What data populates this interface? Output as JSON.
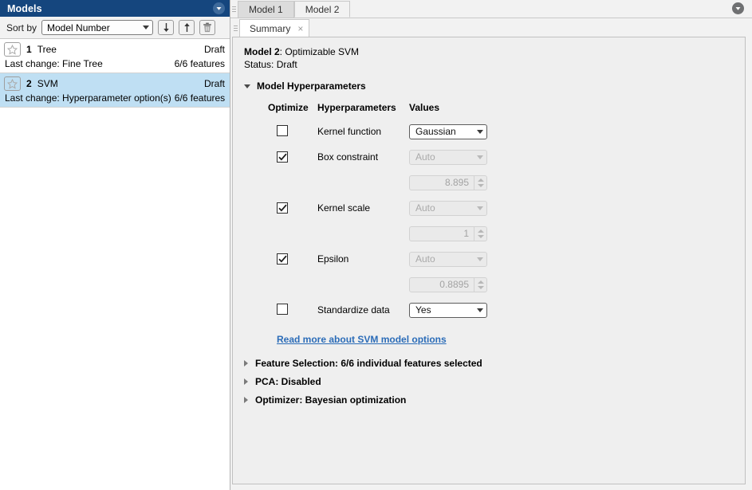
{
  "models_panel": {
    "title": "Models",
    "collapse_icon": "chevron-down-circle-icon",
    "sort": {
      "label": "Sort by",
      "selected": "Model Number",
      "options": [
        "Model Number"
      ],
      "sort_ascending_icon": "arrow-down-icon",
      "sort_descending_icon": "arrow-up-icon",
      "delete_icon": "trash-icon"
    },
    "models": [
      {
        "number": "1",
        "name": "Tree",
        "status": "Draft",
        "last_change": "Last change: Fine Tree",
        "features": "6/6 features",
        "selected": false,
        "favorite_icon": "star-outline-icon"
      },
      {
        "number": "2",
        "name": "SVM",
        "status": "Draft",
        "last_change": "Last change: Hyperparameter option(s)",
        "features": "6/6 features",
        "selected": true,
        "favorite_icon": "star-outline-icon"
      }
    ]
  },
  "workspace": {
    "model_tabs": [
      {
        "label": "Model 1",
        "active": false
      },
      {
        "label": "Model 2",
        "active": true
      }
    ],
    "close_icon": "chevron-down-circle-icon",
    "document_tabs": [
      {
        "label": "Summary",
        "active": true,
        "close_label": "×"
      }
    ]
  },
  "summary": {
    "model_label": "Model 2",
    "model_title_sep": ": ",
    "model_type": "Optimizable SVM",
    "status": "Status: Draft",
    "hyperparameters_section": {
      "title": "Model Hyperparameters",
      "expanded": true,
      "columns": {
        "optimize": "Optimize",
        "hyperparameters": "Hyperparameters",
        "values": "Values"
      },
      "rows": [
        {
          "label": "Kernel function",
          "optimize_checked": false,
          "control": "dropdown",
          "value": "Gaussian",
          "enabled": true,
          "range": null
        },
        {
          "label": "Box constraint",
          "optimize_checked": true,
          "control": "dropdown",
          "value": "Auto",
          "enabled": false,
          "range": "8.895"
        },
        {
          "label": "Kernel scale",
          "optimize_checked": true,
          "control": "dropdown",
          "value": "Auto",
          "enabled": false,
          "range": "1"
        },
        {
          "label": "Epsilon",
          "optimize_checked": true,
          "control": "dropdown",
          "value": "Auto",
          "enabled": false,
          "range": "0.8895"
        },
        {
          "label": "Standardize data",
          "optimize_checked": false,
          "control": "dropdown",
          "value": "Yes",
          "enabled": true,
          "range": null
        }
      ],
      "read_more_link": "Read more about SVM model options"
    },
    "collapsed_sections": [
      {
        "title": "Feature Selection: 6/6 individual features selected",
        "expanded": false
      },
      {
        "title": "PCA: Disabled",
        "expanded": false
      },
      {
        "title": "Optimizer: Bayesian optimization",
        "expanded": false
      }
    ]
  },
  "colors": {
    "titlebar": "#15467e",
    "selected_row": "#bfdff3",
    "link": "#2b6cb8",
    "panel_bg": "#efefef"
  }
}
